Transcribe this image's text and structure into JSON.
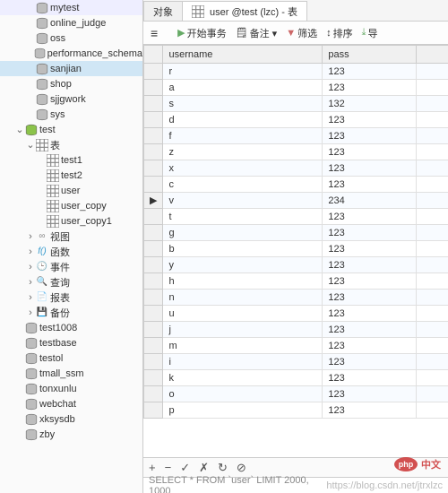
{
  "sidebar": {
    "items": [
      {
        "label": "mytest",
        "indent": 2,
        "icon": "db",
        "expand": ""
      },
      {
        "label": "online_judge",
        "indent": 2,
        "icon": "db",
        "expand": ""
      },
      {
        "label": "oss",
        "indent": 2,
        "icon": "db",
        "expand": ""
      },
      {
        "label": "performance_schema",
        "indent": 2,
        "icon": "db",
        "expand": ""
      },
      {
        "label": "sanjian",
        "indent": 2,
        "icon": "db",
        "expand": "",
        "selected": true
      },
      {
        "label": "shop",
        "indent": 2,
        "icon": "db",
        "expand": ""
      },
      {
        "label": "sjjgwork",
        "indent": 2,
        "icon": "db",
        "expand": ""
      },
      {
        "label": "sys",
        "indent": 2,
        "icon": "db",
        "expand": ""
      },
      {
        "label": "test",
        "indent": 1,
        "icon": "db-open",
        "expand": "⌄"
      },
      {
        "label": "表",
        "indent": 2,
        "icon": "tbl",
        "expand": "⌄"
      },
      {
        "label": "test1",
        "indent": 3,
        "icon": "tbl",
        "expand": ""
      },
      {
        "label": "test2",
        "indent": 3,
        "icon": "tbl",
        "expand": ""
      },
      {
        "label": "user",
        "indent": 3,
        "icon": "tbl",
        "expand": ""
      },
      {
        "label": "user_copy",
        "indent": 3,
        "icon": "tbl",
        "expand": ""
      },
      {
        "label": "user_copy1",
        "indent": 3,
        "icon": "tbl",
        "expand": ""
      },
      {
        "label": "视图",
        "indent": 2,
        "icon": "view",
        "expand": "›"
      },
      {
        "label": "函数",
        "indent": 2,
        "icon": "func",
        "expand": "›"
      },
      {
        "label": "事件",
        "indent": 2,
        "icon": "event",
        "expand": "›"
      },
      {
        "label": "查询",
        "indent": 2,
        "icon": "query",
        "expand": "›"
      },
      {
        "label": "报表",
        "indent": 2,
        "icon": "report",
        "expand": "›"
      },
      {
        "label": "备份",
        "indent": 2,
        "icon": "backup",
        "expand": "›"
      },
      {
        "label": "test1008",
        "indent": 1,
        "icon": "db",
        "expand": ""
      },
      {
        "label": "testbase",
        "indent": 1,
        "icon": "db",
        "expand": ""
      },
      {
        "label": "testol",
        "indent": 1,
        "icon": "db",
        "expand": ""
      },
      {
        "label": "tmall_ssm",
        "indent": 1,
        "icon": "db",
        "expand": ""
      },
      {
        "label": "tonxunlu",
        "indent": 1,
        "icon": "db",
        "expand": ""
      },
      {
        "label": "webchat",
        "indent": 1,
        "icon": "db",
        "expand": ""
      },
      {
        "label": "xksysdb",
        "indent": 1,
        "icon": "db",
        "expand": ""
      },
      {
        "label": "zby",
        "indent": 1,
        "icon": "db",
        "expand": ""
      }
    ]
  },
  "tabs": {
    "tab1": "对象",
    "tab2": "user @test (lzc) - 表"
  },
  "toolbar": {
    "menu": "≡",
    "begin": "开始事务",
    "memo": "备注 ▾",
    "filter": "筛选",
    "sort": "排序",
    "export": "导"
  },
  "grid": {
    "col1": "username",
    "col2": "pass",
    "rows": [
      {
        "u": "r",
        "p": "123"
      },
      {
        "u": "a",
        "p": "123"
      },
      {
        "u": "s",
        "p": "132"
      },
      {
        "u": "d",
        "p": "123"
      },
      {
        "u": "f",
        "p": "123"
      },
      {
        "u": "z",
        "p": "123"
      },
      {
        "u": "x",
        "p": "123"
      },
      {
        "u": "c",
        "p": "123"
      },
      {
        "u": "v",
        "p": "234",
        "cur": true
      },
      {
        "u": "t",
        "p": "123"
      },
      {
        "u": "g",
        "p": "123"
      },
      {
        "u": "b",
        "p": "123"
      },
      {
        "u": "y",
        "p": "123"
      },
      {
        "u": "h",
        "p": "123"
      },
      {
        "u": "n",
        "p": "123"
      },
      {
        "u": "u",
        "p": "123"
      },
      {
        "u": "j",
        "p": "123"
      },
      {
        "u": "m",
        "p": "123"
      },
      {
        "u": "i",
        "p": "123"
      },
      {
        "u": "k",
        "p": "123"
      },
      {
        "u": "o",
        "p": "123"
      },
      {
        "u": "p",
        "p": "123"
      }
    ]
  },
  "bottombar": {
    "add": "+",
    "del": "−",
    "ok": "✓",
    "cancel": "✗",
    "refresh": "↻",
    "stop": "⊘"
  },
  "status": {
    "query": "SELECT * FROM `user` LIMIT 2000, 1000",
    "source": "https://blog.csdn.net/jtrxlzc"
  },
  "watermark": {
    "logo": "php",
    "text": "中文"
  }
}
